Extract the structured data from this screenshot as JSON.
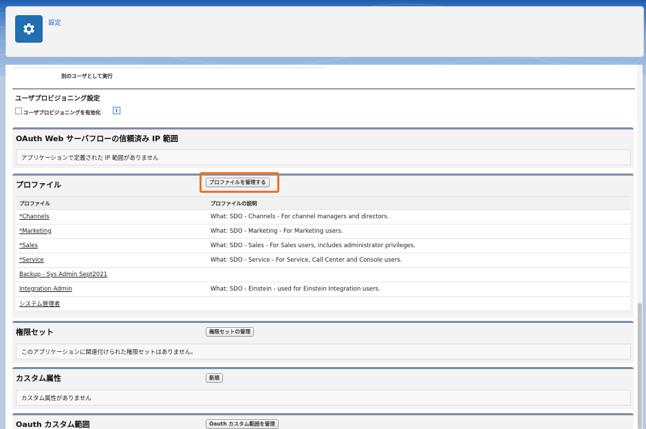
{
  "header": {
    "title": "設定",
    "icon": "gear-icon",
    "accent_color": "#1f6fb2"
  },
  "run_as": {
    "label": "別のユーザとして実行"
  },
  "provisioning": {
    "title": "ユーザプロビジョニング設定",
    "checkbox_label": "ユーザプロビジョニングを有効化",
    "info_glyph": "i"
  },
  "oauth_ip": {
    "title": "OAuth Web サーバフローの信頼済み IP 範囲",
    "empty_text": "アプリケーションで定義された IP 範囲がありません"
  },
  "profiles": {
    "title": "プロファイル",
    "manage_button": "プロファイルを管理する",
    "highlight_color": "#e8742a",
    "columns": [
      "プロファイル",
      "プロファイルの説明"
    ],
    "rows": [
      {
        "name": "*Channels",
        "description": "What: SDO - Channels - For channel managers and directors."
      },
      {
        "name": "*Marketing",
        "description": "What: SDO - Marketing - For Marketing users."
      },
      {
        "name": "*Sales",
        "description": "What: SDO - Sales - For Sales users, includes administrator privileges."
      },
      {
        "name": "*Service",
        "description": "What: SDO - Service - For Service, Call Center and Console users."
      },
      {
        "name": "Backup - Sys Admin Sept2021",
        "description": ""
      },
      {
        "name": "Integration Admin",
        "description": "What: SDO - Einstein - used for Einstein Integration users."
      },
      {
        "name": "システム管理者",
        "description": ""
      }
    ]
  },
  "permission_sets": {
    "title": "権限セット",
    "manage_button": "権限セットの管理",
    "empty_text": "このアプリケーションに関連付けられた権限セットはありません。"
  },
  "custom_attributes": {
    "title": "カスタム属性",
    "new_button": "新規",
    "empty_text": "カスタム属性がありません"
  },
  "oauth_scopes": {
    "title": "Oauth カスタム範囲",
    "manage_button": "Oauth カスタム範囲を管理"
  }
}
